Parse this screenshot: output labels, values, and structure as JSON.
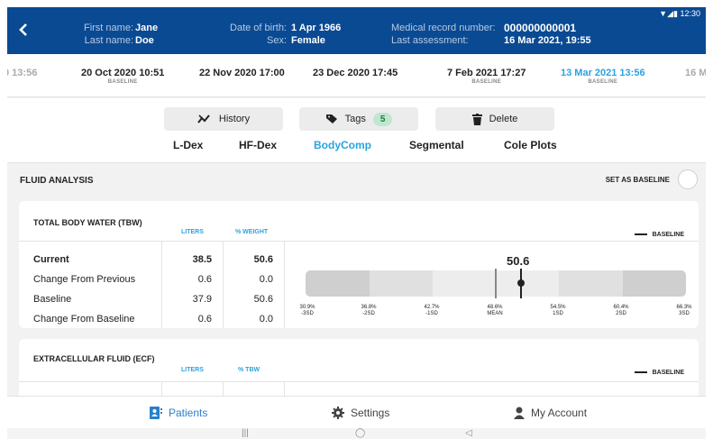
{
  "status": {
    "time": "12:30",
    "icons": "▼◢▮"
  },
  "header": {
    "first_name_label": "First name:",
    "first_name": "Jane",
    "last_name_label": "Last name:",
    "last_name": "Doe",
    "dob_label": "Date of birth:",
    "dob": "1 Apr 1966",
    "sex_label": "Sex:",
    "sex": "Female",
    "mrn_label": "Medical record number:",
    "mrn": "000000000001",
    "last_assessment_label": "Last assessment:",
    "last_assessment": "16 Mar 2021, 19:55"
  },
  "dates": [
    {
      "text": "0 13:56",
      "sub": ""
    },
    {
      "text": "20 Oct 2020 10:51",
      "sub": "BASELINE"
    },
    {
      "text": "22 Nov 2020 17:00",
      "sub": ""
    },
    {
      "text": "23 Dec 2020 17:45",
      "sub": ""
    },
    {
      "text": "7 Feb 2021 17:27",
      "sub": "BASELINE"
    },
    {
      "text": "13 Mar 2021 13:56",
      "sub": "BASELINE"
    },
    {
      "text": "16 M",
      "sub": ""
    }
  ],
  "actions": {
    "history": "History",
    "tags": "Tags",
    "tags_count": "5",
    "delete": "Delete"
  },
  "tabs": [
    "L-Dex",
    "HF-Dex",
    "BodyComp",
    "Segmental",
    "Cole Plots"
  ],
  "active_tab": "BodyComp",
  "section": {
    "title": "FLUID ANALYSIS",
    "set_baseline": "SET AS BASELINE"
  },
  "tbw": {
    "title": "TOTAL BODY WATER (TBW)",
    "col1": "LITERS",
    "col2": "% WEIGHT",
    "legend": "BASELINE",
    "rows": [
      {
        "label": "Current",
        "v1": "38.5",
        "v2": "50.6"
      },
      {
        "label": "Change From Previous",
        "v1": "0.6",
        "v2": "0.0"
      },
      {
        "label": "Baseline",
        "v1": "37.9",
        "v2": "50.6"
      },
      {
        "label": "Change From Baseline",
        "v1": "0.6",
        "v2": "0.0"
      }
    ],
    "gauge_value": "50.6",
    "ticks": [
      {
        "pct": "30.9%",
        "sd": "-3SD"
      },
      {
        "pct": "36.8%",
        "sd": "-2SD"
      },
      {
        "pct": "42.7%",
        "sd": "-1SD"
      },
      {
        "pct": "48.6%",
        "sd": "MEAN"
      },
      {
        "pct": "54.5%",
        "sd": "1SD"
      },
      {
        "pct": "60.4%",
        "sd": "2SD"
      },
      {
        "pct": "66.3%",
        "sd": "3SD"
      }
    ]
  },
  "ecf": {
    "title": "EXTRACELLULAR FLUID (ECF)",
    "col1": "LITERS",
    "col2": "% TBW",
    "legend": "BASELINE"
  },
  "nav": {
    "patients": "Patients",
    "settings": "Settings",
    "account": "My Account"
  },
  "colors": {
    "header": "#0a4a93",
    "accent": "#2aa3e0",
    "tag_badge": "#bfe7d0"
  }
}
